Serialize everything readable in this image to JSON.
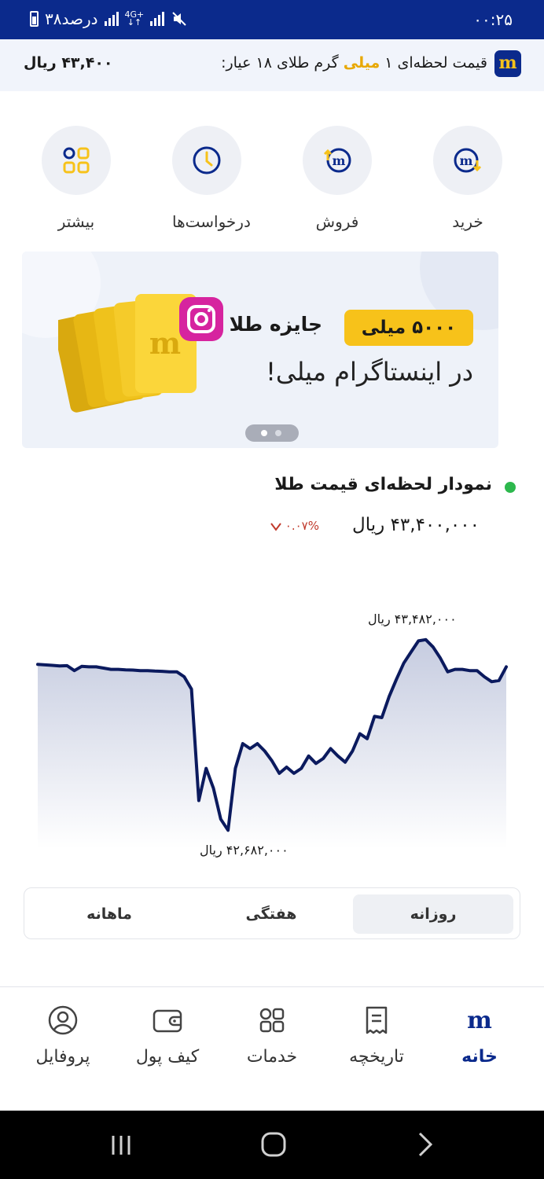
{
  "status_bar": {
    "time": "۰۰:۲۵",
    "battery_text": "۳۸درصد",
    "network": "4G+"
  },
  "ticker": {
    "label_before": "قیمت لحظه‌ای ۱ ",
    "label_brand": "میلی",
    "label_after": " گرم طلای ۱۸ عیار:",
    "price": "۴۳,۴۰۰ ریال",
    "logo_letter": "m"
  },
  "quick_actions": [
    {
      "label": "خرید",
      "icon": "buy-icon"
    },
    {
      "label": "فروش",
      "icon": "sell-icon"
    },
    {
      "label": "درخواست‌ها",
      "icon": "clock-icon"
    },
    {
      "label": "بیشتر",
      "icon": "grid-icon"
    }
  ],
  "banner": {
    "pill_text": "۵۰۰۰ میلی",
    "prize_text": "جایزه طلا",
    "line2": "در اینستاگرام میلی!",
    "slide_count": 2,
    "active_slide": 1
  },
  "chart_section": {
    "title": "نمودار لحظه‌ای قیمت طلا",
    "current_price": "۴۳,۴۰۰,۰۰۰ ریال",
    "change": "۰.۰۷%",
    "change_direction": "down",
    "high_label": "۴۳,۴۸۲,۰۰۰ ریال",
    "low_label": "۴۲,۶۸۲,۰۰۰ ریال"
  },
  "chart_data": {
    "type": "area",
    "title": "",
    "xlabel": "",
    "ylabel": "",
    "max_value": 43482000,
    "min_value": 42682000,
    "series": [
      {
        "values": [
          43370000,
          43368000,
          43366000,
          43364000,
          43365000,
          43345000,
          43362000,
          43360000,
          43360000,
          43355000,
          43350000,
          43350000,
          43348000,
          43347000,
          43345000,
          43345000,
          43343000,
          43342000,
          43340000,
          43340000,
          43320000,
          43270000,
          42820000,
          42950000,
          42870000,
          42745000,
          42700000,
          42950000,
          43050000,
          43030000,
          43050000,
          43020000,
          42980000,
          42930000,
          42955000,
          42930000,
          42950000,
          43000000,
          42970000,
          42990000,
          43030000,
          43000000,
          42975000,
          43020000,
          43090000,
          43070000,
          43160000,
          43155000,
          43240000,
          43310000,
          43375000,
          43420000,
          43465000,
          43470000,
          43440000,
          43395000,
          43340000,
          43350000,
          43350000,
          43345000,
          43345000,
          43320000,
          43300000,
          43305000,
          43360000
        ]
      }
    ],
    "colors": {
      "line": "#0b1a5e",
      "fill_top": "#c6cce0",
      "fill_bottom": "#ffffff"
    }
  },
  "period_tabs": [
    {
      "label": "روزانه",
      "active": true
    },
    {
      "label": "هفتگی",
      "active": false
    },
    {
      "label": "ماهانه",
      "active": false
    }
  ],
  "bottom_nav": [
    {
      "label": "خانه",
      "icon": "home-logo-icon",
      "active": true
    },
    {
      "label": "تاریخچه",
      "icon": "history-icon",
      "active": false
    },
    {
      "label": "خدمات",
      "icon": "services-icon",
      "active": false
    },
    {
      "label": "کیف پول",
      "icon": "wallet-icon",
      "active": false
    },
    {
      "label": "پروفایل",
      "icon": "profile-icon",
      "active": false
    }
  ],
  "colors": {
    "brand_blue": "#0b2a8c",
    "gold": "#f7c21a",
    "live_green": "#2db84d",
    "down_red": "#c0392b"
  }
}
